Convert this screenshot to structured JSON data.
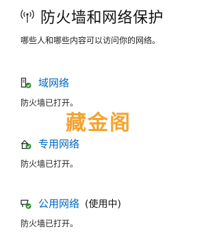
{
  "header": {
    "title": "防火墙和网络保护",
    "icon": "wifi-signal-icon"
  },
  "subtitle": "哪些人和哪些内容可以访问你的网络。",
  "networks": [
    {
      "label": "域网络",
      "suffix": "",
      "status": "防火墙已打开。",
      "icon": "domain-network-icon"
    },
    {
      "label": "专用网络",
      "suffix": "",
      "status": "防火墙已打开。",
      "icon": "private-network-icon"
    },
    {
      "label": "公用网络",
      "suffix": "(使用中)",
      "status": "防火墙已打开。",
      "icon": "public-network-icon"
    }
  ],
  "watermark": "藏金阁",
  "colors": {
    "link": "#0067c0",
    "check_green": "#2e8b30",
    "watermark": "#f29a1a"
  }
}
